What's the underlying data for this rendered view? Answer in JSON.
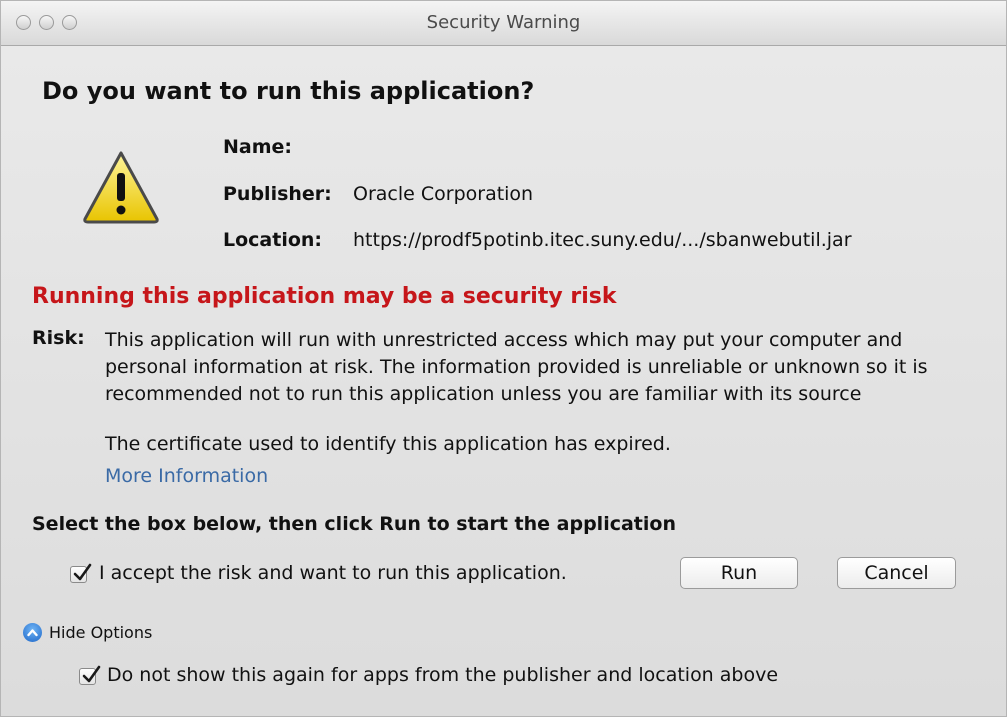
{
  "window": {
    "title": "Security Warning"
  },
  "dialog": {
    "heading": "Do you want to run this application?",
    "name_label": "Name:",
    "name_value": "",
    "publisher_label": "Publisher:",
    "publisher_value": "Oracle Corporation",
    "location_label": "Location:",
    "location_value": "https://prodf5potinb.itec.suny.edu/.../sbanwebutil.jar",
    "risk_title": "Running this application may be a security risk",
    "risk_label": "Risk:",
    "risk_text": "This application will run with unrestricted access which may put your computer and personal information at risk. The information provided is unreliable or unknown so it is recommended not to run this application unless you are familiar with its source",
    "cert_text": "The certificate used to identify this application has expired.",
    "more_info_link": "More Information",
    "select_instruction": "Select the box below, then click Run to start the application",
    "accept_checkbox_label": "I accept the risk and want to run this application.",
    "accept_checked": true,
    "run_button": "Run",
    "cancel_button": "Cancel",
    "hide_options_label": "Hide Options",
    "dont_show_checkbox_label": "Do not show this again for apps from the publisher and location above",
    "dont_show_checked": true
  },
  "icons": {
    "warning": "warning-icon",
    "hide_options": "chevron-up-icon",
    "checkmark": "checkmark-icon"
  },
  "colors": {
    "risk_title": "#c6161a",
    "link": "#3a6aa6",
    "warning_fill": "#f7e12a"
  }
}
